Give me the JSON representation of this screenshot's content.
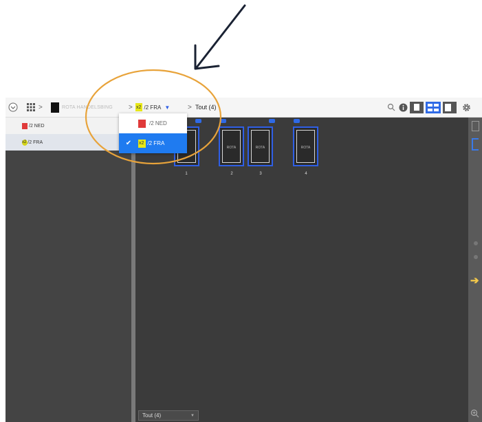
{
  "breadcrumb": {
    "document_name": "ROTA HANDELSBING",
    "current_section_badge": "x2",
    "current_section_label": "/2 FRA",
    "current_view": "Tout (4)"
  },
  "language_list": [
    {
      "label": "/2 NED",
      "color": "#e03a3a"
    },
    {
      "label": "/2 FRA",
      "badge": "x2",
      "color": "#d4d418"
    }
  ],
  "dropdown": {
    "options": [
      {
        "label": "/2 NED",
        "color": "#e03a3a",
        "checked": false
      },
      {
        "badge": "x2",
        "label": "/2 FRA",
        "color": "#e8e817",
        "checked": true
      }
    ]
  },
  "pages": [
    {
      "number": "1",
      "mini_label": ""
    },
    {
      "number": "2",
      "mini_label": "ROTA"
    },
    {
      "number": "3",
      "mini_label": "ROTA"
    },
    {
      "number": "4",
      "mini_label": "ROTA"
    }
  ],
  "footer": {
    "view_select": "Tout (4)"
  },
  "colors": {
    "accent": "#2f5fe6",
    "annotation": "#e8a33a",
    "arrow": "#1a2233"
  }
}
